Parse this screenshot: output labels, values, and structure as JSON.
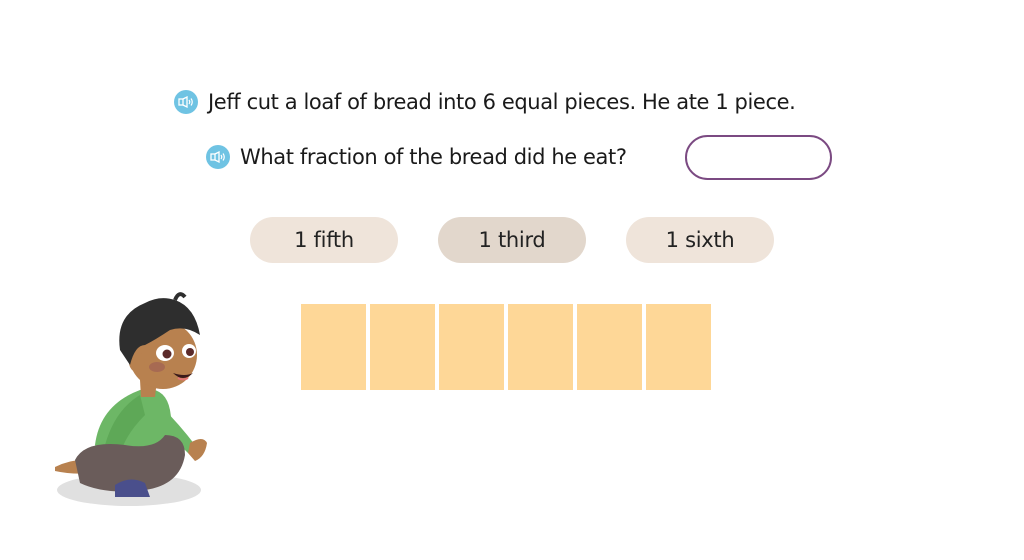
{
  "question": {
    "lines": [
      {
        "text": "Jeff cut a loaf of bread into 6 equal pieces. He ate 1 piece.",
        "icon": "speaker-icon"
      },
      {
        "text": "What fraction of the bread did he eat?",
        "icon": "speaker-icon"
      }
    ],
    "answer": {
      "value": "",
      "placeholder": ""
    }
  },
  "choices": [
    {
      "label": "1 fifth"
    },
    {
      "label": "1 third",
      "state": "hover"
    },
    {
      "label": "1 sixth"
    }
  ],
  "bread": {
    "pieces": 6,
    "color": "#fed797"
  },
  "colors": {
    "speaker": "#6fc3e3",
    "answer_border": "#7b4a82",
    "choice_bg": "#efe4da"
  }
}
